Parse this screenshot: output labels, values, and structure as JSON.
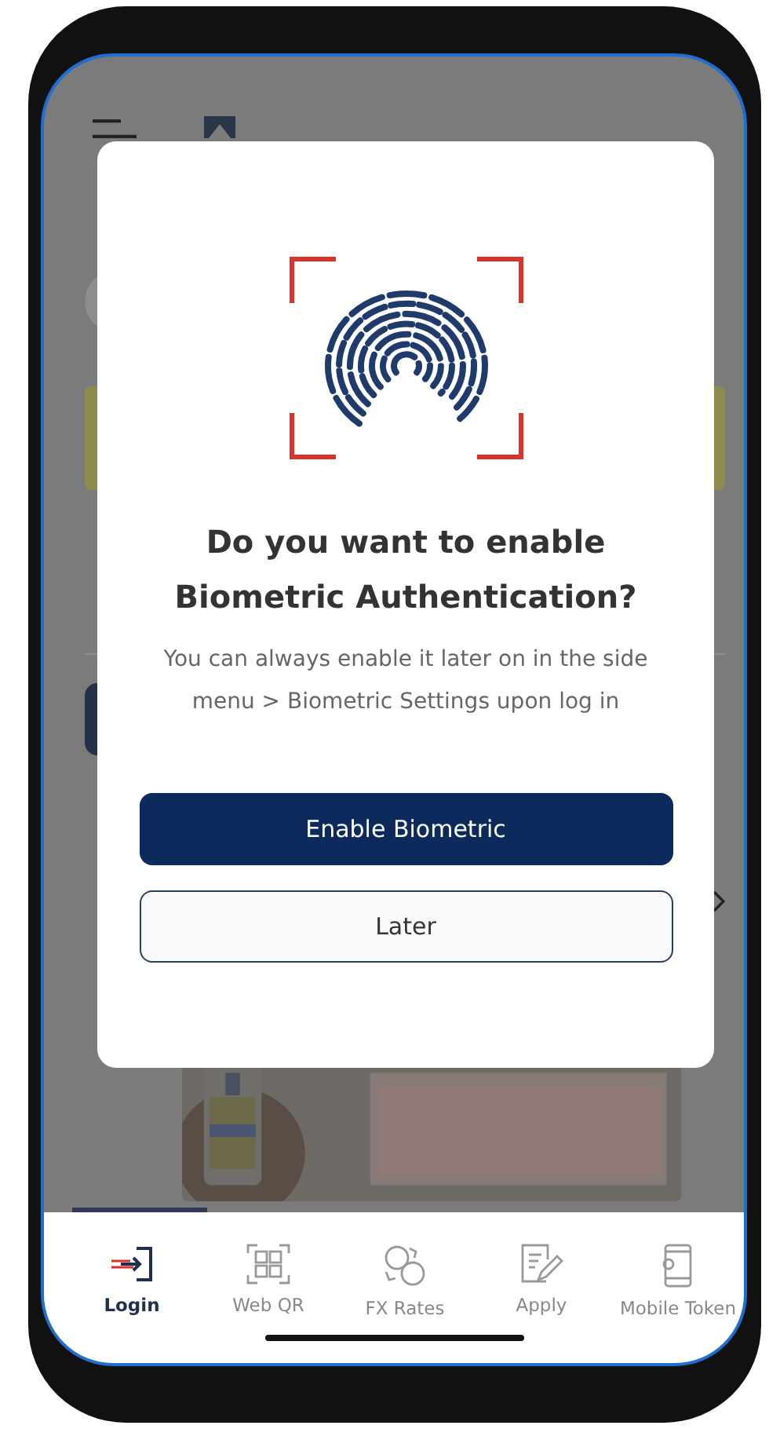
{
  "dialog": {
    "title": "Do you want to enable Biometric Authentication?",
    "message": "You can always enable it later on in the side menu > Biometric Settings upon log in",
    "buttons": [
      {
        "label": "Enable Biometric",
        "kind": "primary"
      },
      {
        "label": "Later",
        "kind": "secondary"
      }
    ]
  },
  "bottom_nav": {
    "items": [
      {
        "label": "Login",
        "selected": true
      },
      {
        "label": "Web QR",
        "selected": false
      },
      {
        "label": "FX Rates",
        "selected": false
      },
      {
        "label": "Apply",
        "selected": false
      },
      {
        "label": "Mobile Token",
        "selected": false
      }
    ]
  }
}
